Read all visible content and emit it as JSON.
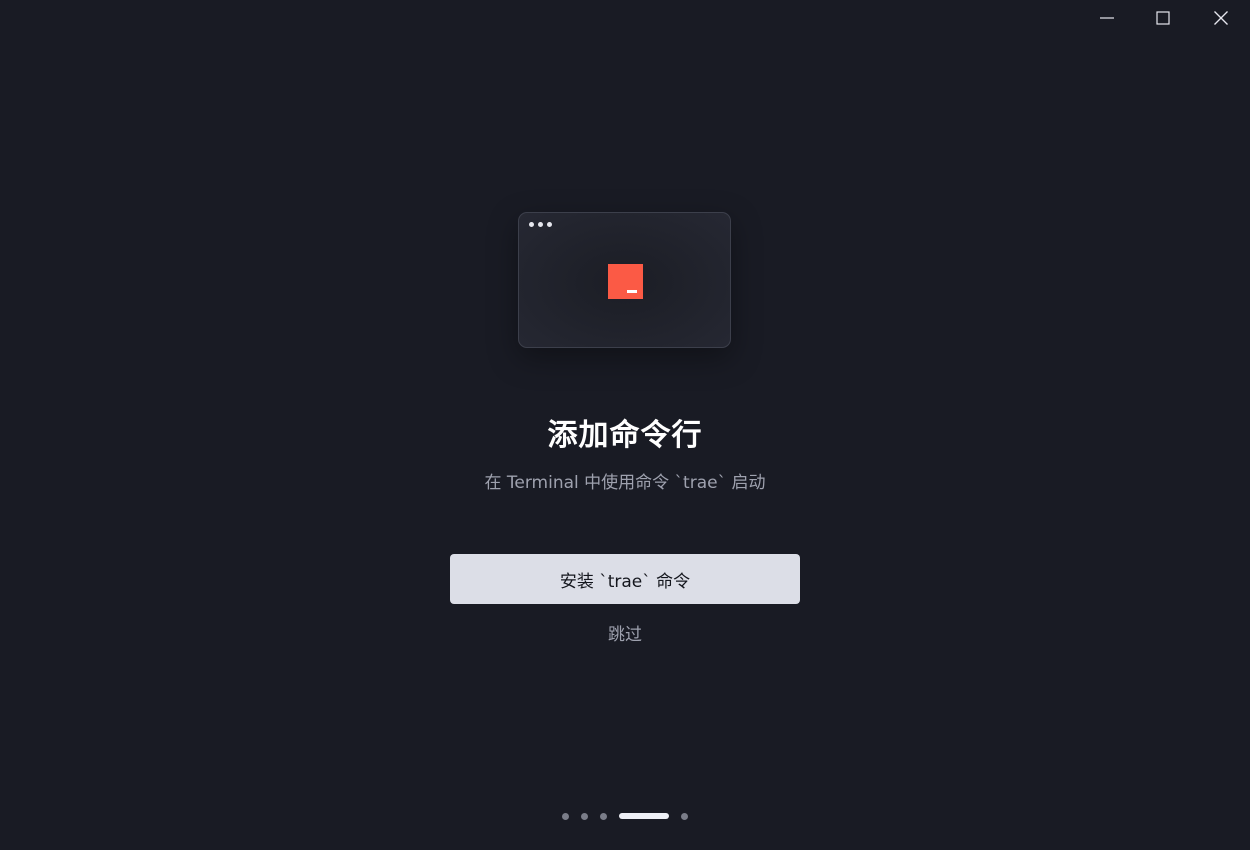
{
  "window_controls": {
    "minimize_icon": "minimize-icon",
    "maximize_icon": "maximize-icon",
    "close_icon": "close-icon"
  },
  "illustration": {
    "icon": "terminal-window-icon",
    "accent_color": "#fb5a45"
  },
  "onboarding": {
    "title": "添加命令行",
    "subtitle": "在 Terminal 中使用命令 `trae` 启动",
    "install_button_label": "安装 `trae` 命令",
    "skip_label": "跳过"
  },
  "pager": {
    "total_steps": 5,
    "active_step": 4
  },
  "colors": {
    "background": "#191b24",
    "button_background": "#dcdee7",
    "accent": "#fb5a45"
  }
}
